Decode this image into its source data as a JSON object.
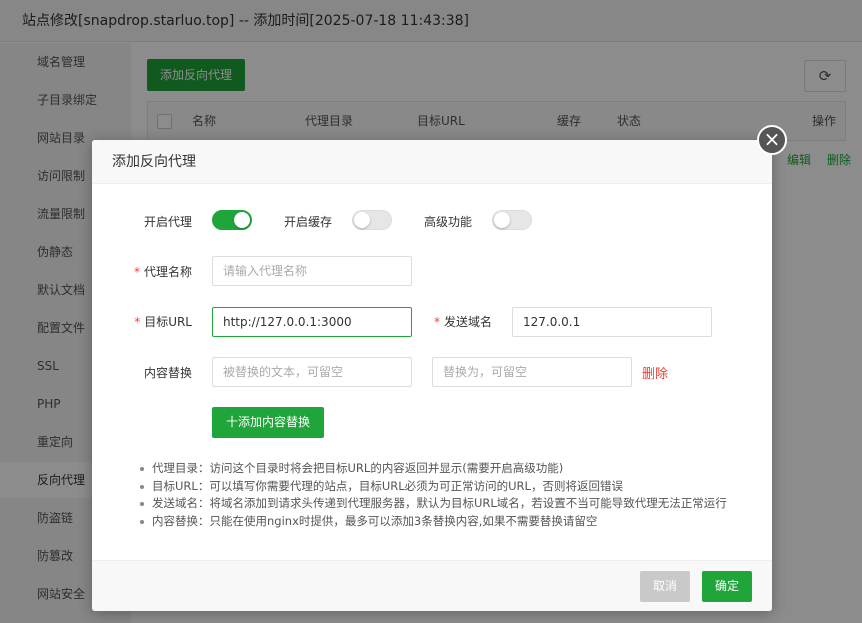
{
  "window": {
    "title": "站点修改[snapdrop.starluo.top] -- 添加时间[2025-07-18 11:43:38]"
  },
  "sidebar": {
    "items": [
      {
        "label": "域名管理"
      },
      {
        "label": "子目录绑定"
      },
      {
        "label": "网站目录"
      },
      {
        "label": "访问限制"
      },
      {
        "label": "流量限制"
      },
      {
        "label": "伪静态"
      },
      {
        "label": "默认文档"
      },
      {
        "label": "配置文件"
      },
      {
        "label": "SSL"
      },
      {
        "label": "PHP"
      },
      {
        "label": "重定向"
      },
      {
        "label": "反向代理"
      },
      {
        "label": "防盗链"
      },
      {
        "label": "防篡改"
      },
      {
        "label": "网站安全"
      }
    ],
    "active": "反向代理"
  },
  "main": {
    "add_button": "添加反向代理",
    "refresh_icon": "refresh-icon",
    "table": {
      "columns": [
        "名称",
        "代理目录",
        "目标URL",
        "缓存",
        "状态",
        "操作"
      ],
      "row_actions": [
        "编辑",
        "删除"
      ]
    }
  },
  "dialog": {
    "title": "添加反向代理",
    "close_icon": "close-icon",
    "toggles": [
      {
        "label": "开启代理",
        "on": true
      },
      {
        "label": "开启缓存",
        "on": false
      },
      {
        "label": "高级功能",
        "on": false
      }
    ],
    "proxy_name": {
      "label": "代理名称",
      "value": "",
      "placeholder": "请输入代理名称"
    },
    "target_url": {
      "label": "目标URL",
      "value": "http://127.0.0.1:3000"
    },
    "send_domain": {
      "label": "发送域名",
      "value": "127.0.0.1"
    },
    "content_replace": {
      "label": "内容替换",
      "from_placeholder": "被替换的文本，可留空",
      "to_placeholder": "替换为，可留空",
      "delete_label": "删除",
      "add_button": "十添加内容替换"
    },
    "notes": [
      "代理目录：访问这个目录时将会把目标URL的内容返回并显示(需要开启高级功能)",
      "目标URL：可以填写你需要代理的站点，目标URL必须为可正常访问的URL，否则将返回错误",
      "发送域名：将域名添加到请求头传递到代理服务器，默认为目标URL域名，若设置不当可能导致代理无法正常运行",
      "内容替换：只能在使用nginx时提供，最多可以添加3条替换内容,如果不需要替换请留空"
    ],
    "cancel_button": "取消",
    "ok_button": "确定"
  },
  "colors": {
    "accent": "#20a53a",
    "danger": "#f04134"
  }
}
